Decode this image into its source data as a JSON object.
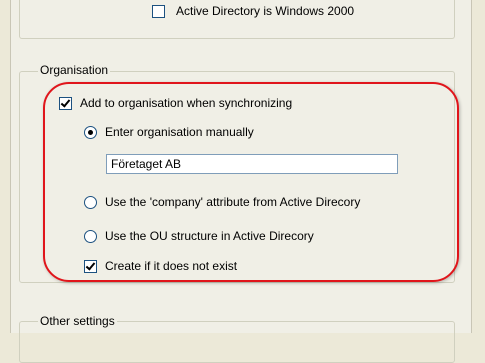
{
  "top": {
    "cb_label": "Active Directory is Windows 2000"
  },
  "organisation": {
    "legend": "Organisation",
    "add_to_org": {
      "label": "Add to organisation when synchronizing",
      "checked": true
    },
    "manual": {
      "label": "Enter organisation manually",
      "selected": true
    },
    "manual_value": "Företaget AB",
    "company_attr": {
      "label": "Use the 'company' attribute from Active Direcory",
      "selected": false
    },
    "ou_structure": {
      "label": "Use the OU structure in Active Direcory",
      "selected": false
    },
    "create_if_missing": {
      "label": "Create if it does not exist",
      "checked": true
    }
  },
  "other": {
    "legend": "Other settings"
  },
  "colors": {
    "highlight": "#e0151b",
    "window_bg": "#f0efe6"
  }
}
